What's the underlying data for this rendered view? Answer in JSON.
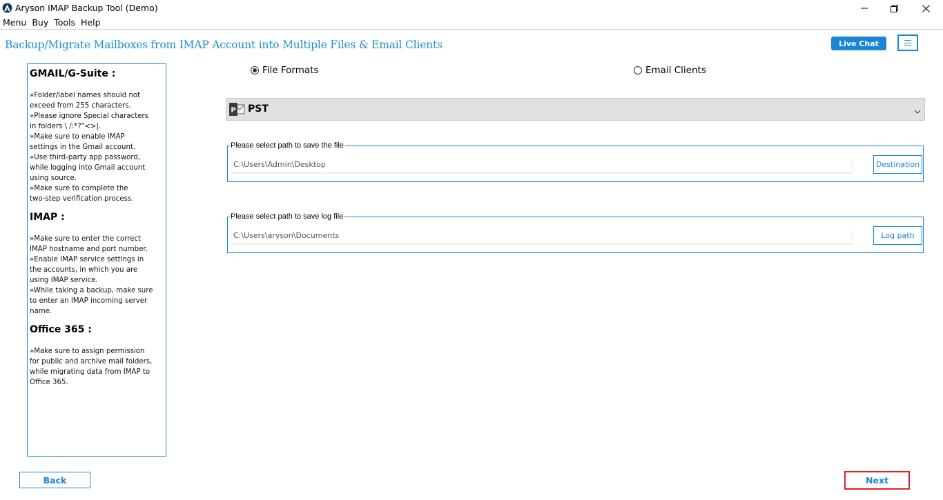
{
  "window": {
    "title": "Aryson IMAP Backup Tool (Demo)",
    "icon": "aryson-logo-icon",
    "controls": [
      "minimize-icon",
      "restore-icon",
      "close-icon"
    ]
  },
  "menubar": {
    "items": [
      {
        "label": "Menu"
      },
      {
        "label": "Buy"
      },
      {
        "label": "Tools"
      },
      {
        "label": "Help"
      }
    ]
  },
  "header": {
    "title": "Backup/Migrate Mailboxes from IMAP Account into Multiple Files & Email Clients",
    "live_chat_label": "Live Chat",
    "menu_icon": "hamburger-menu-icon"
  },
  "info_panel": {
    "sections": [
      {
        "heading": "GMAIL/G-Suite :",
        "lines": [
          "»Folder/label names should not",
          "exceed from 255 characters.",
          "»Please ignore Special characters",
          "in folders  \\ /:*?\"<>|.",
          "»Make sure to enable IMAP",
          "settings in the Gmail account.",
          "»Use third-party app password,",
          "while logging into Gmail account",
          "using source.",
          "»Make sure to complete the",
          "two-step verification process."
        ]
      },
      {
        "heading": "IMAP :",
        "lines": [
          "»Make sure to enter the correct",
          "IMAP hostname and port number.",
          "»Enable IMAP service settings in",
          "the accounts, in which you are",
          "using IMAP service.",
          "»While taking a backup, make sure",
          "to enter an IMAP incoming server",
          "name."
        ]
      },
      {
        "heading": "Office 365 :",
        "lines": [
          "»Make sure to assign permission",
          "for public and archive mail folders,",
          "while migrating data from IMAP to",
          "Office 365."
        ]
      }
    ]
  },
  "output_type": {
    "options": [
      {
        "label": "File Formats",
        "selected": true
      },
      {
        "label": "Email Clients",
        "selected": false
      }
    ]
  },
  "format_select": {
    "selected": "PST",
    "icon": "outlook-pst-icon"
  },
  "save_path": {
    "legend": "Please select path to save the file",
    "value": "C:\\Users\\Admin\\Desktop",
    "button_label": "Destination"
  },
  "log_path": {
    "legend": "Please select path to save log file",
    "value": "C:\\Users\\aryson\\Documents",
    "button_label": "Log path"
  },
  "footer": {
    "back_label": "Back",
    "next_label": "Next"
  },
  "colors": {
    "accent": "#1a86d9",
    "title_blue": "#1c8fd2",
    "highlight_red": "#e51f26",
    "select_bg": "#e1e1e1"
  }
}
